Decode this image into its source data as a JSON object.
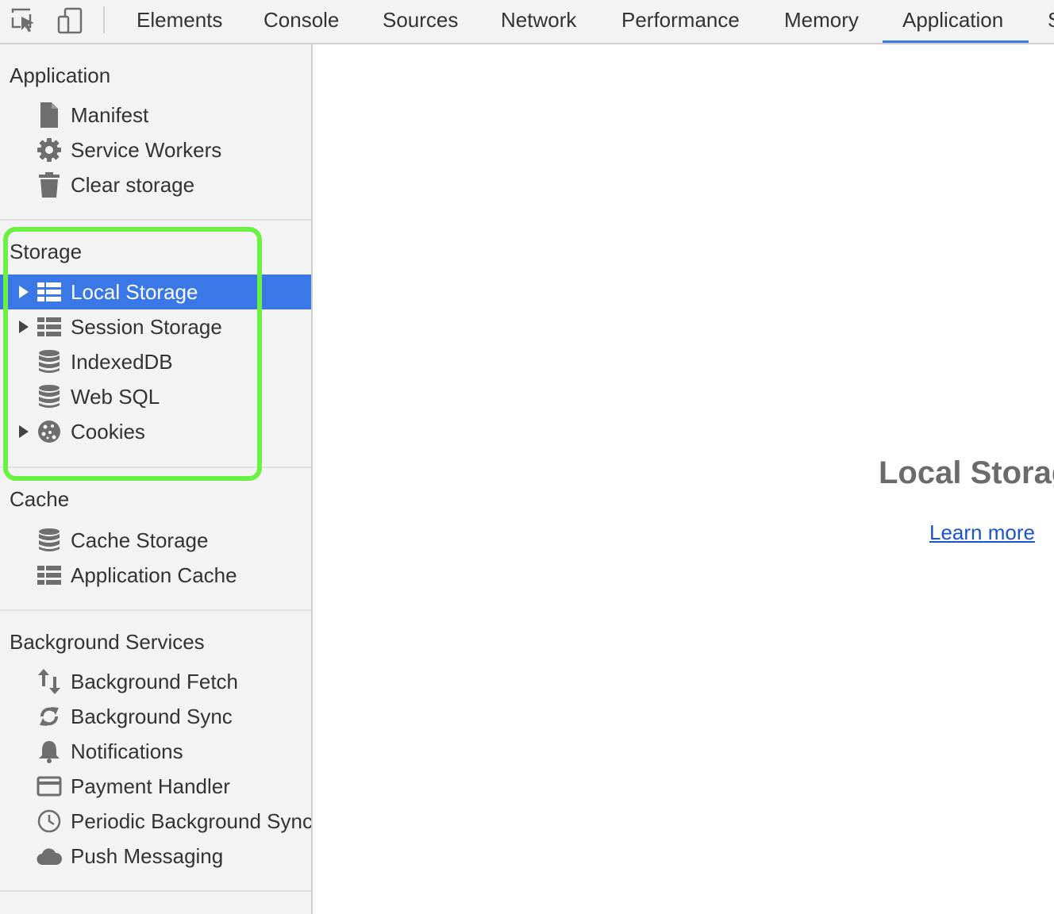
{
  "toolbar": {
    "inspect_icon": "inspect-element-icon",
    "device_icon": "device-toolbar-icon",
    "tabs": [
      {
        "label": "Elements"
      },
      {
        "label": "Console"
      },
      {
        "label": "Sources"
      },
      {
        "label": "Network"
      },
      {
        "label": "Performance"
      },
      {
        "label": "Memory"
      },
      {
        "label": "Application"
      },
      {
        "label": "S"
      }
    ],
    "active_tab": "Application"
  },
  "sidebar": {
    "application": {
      "title": "Application",
      "items": [
        {
          "label": "Manifest",
          "icon": "document-icon"
        },
        {
          "label": "Service Workers",
          "icon": "gear-icon"
        },
        {
          "label": "Clear storage",
          "icon": "trash-icon"
        }
      ]
    },
    "storage": {
      "title": "Storage",
      "items": [
        {
          "label": "Local Storage",
          "icon": "grid-icon",
          "expandable": true,
          "selected": true
        },
        {
          "label": "Session Storage",
          "icon": "grid-icon",
          "expandable": true
        },
        {
          "label": "IndexedDB",
          "icon": "database-icon"
        },
        {
          "label": "Web SQL",
          "icon": "database-icon"
        },
        {
          "label": "Cookies",
          "icon": "cookie-icon",
          "expandable": true
        }
      ]
    },
    "cache": {
      "title": "Cache",
      "items": [
        {
          "label": "Cache Storage",
          "icon": "database-icon"
        },
        {
          "label": "Application Cache",
          "icon": "grid-icon"
        }
      ]
    },
    "background": {
      "title": "Background Services",
      "items": [
        {
          "label": "Background Fetch",
          "icon": "up-down-arrows-icon"
        },
        {
          "label": "Background Sync",
          "icon": "sync-icon"
        },
        {
          "label": "Notifications",
          "icon": "bell-icon"
        },
        {
          "label": "Payment Handler",
          "icon": "credit-card-icon"
        },
        {
          "label": "Periodic Background Sync",
          "icon": "clock-icon"
        },
        {
          "label": "Push Messaging",
          "icon": "cloud-icon"
        }
      ]
    }
  },
  "main": {
    "title": "Local Storage",
    "link": "Learn more"
  },
  "colors": {
    "selected": "#3b78e7",
    "highlight": "#6cf046",
    "link": "#1a55c8",
    "tab_underline": "#3b7de0"
  }
}
